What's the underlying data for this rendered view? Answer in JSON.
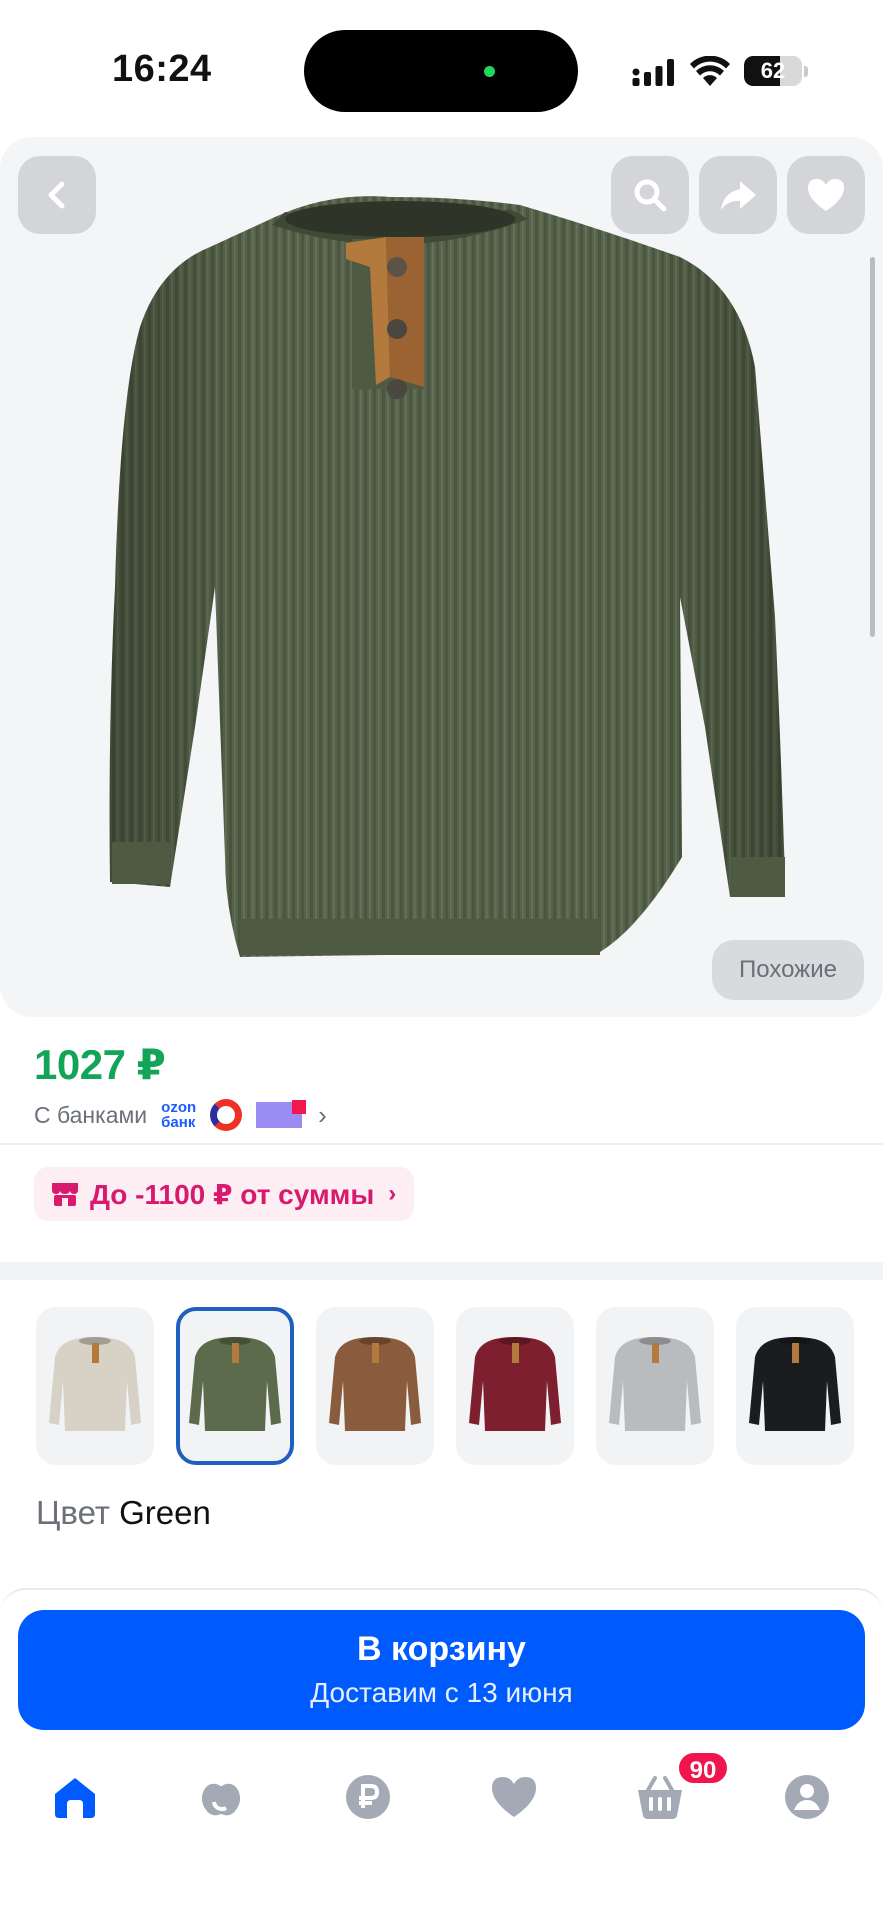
{
  "status_bar": {
    "time": "16:24",
    "battery_level": "62",
    "battery_fraction": 0.62
  },
  "product": {
    "image_name": "green long-sleeve henley shirt",
    "similar_label": "Похожие"
  },
  "price_block": {
    "price": "1027 ₽",
    "banks_label": "С банками",
    "ozon_bank_line1": "ozon",
    "ozon_bank_line2": "банк"
  },
  "promo": {
    "text": "До -1100 ₽ от суммы"
  },
  "colors": {
    "label_key": "Цвет",
    "label_value": "Green",
    "swatches": [
      {
        "name": "beige",
        "color": "#d8d2c6"
      },
      {
        "name": "green",
        "color": "#5c6b4c"
      },
      {
        "name": "brown",
        "color": "#8a5c3d"
      },
      {
        "name": "burgundy",
        "color": "#7d1f2f"
      },
      {
        "name": "light-gray",
        "color": "#b9bbbf"
      },
      {
        "name": "black",
        "color": "#1b1c1f"
      }
    ],
    "selected_index": 1
  },
  "cart_button": {
    "title": "В корзину",
    "subtitle": "Доставим с 13 июня"
  },
  "tabbar": {
    "cart_badge": "90",
    "active_color": "#005bff",
    "inactive_color": "#a3aab5",
    "tabs": [
      "home",
      "fresh",
      "finance",
      "favorites",
      "cart",
      "profile"
    ]
  }
}
